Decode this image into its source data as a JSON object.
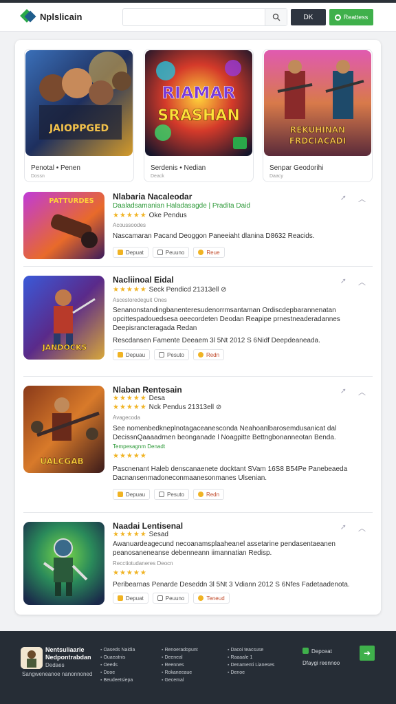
{
  "header": {
    "brand": "Nplslicain",
    "search_placeholder": "",
    "dark_button": "DK",
    "green_button": "Reattess"
  },
  "featured": [
    {
      "title": "Penotal • Penen",
      "sub": "Dossn"
    },
    {
      "title": "Serdenis • Nedian",
      "sub": "Deack"
    },
    {
      "title": "Senpar Geodorihi",
      "sub": "Daacy"
    }
  ],
  "featured_art": [
    {
      "text1": "JAIOPPGED",
      "text2": ""
    },
    {
      "text1": "RIAMAR",
      "text2": "SRASHAN"
    },
    {
      "text1": "REKUHINAN",
      "text2": "FRDCIACADI"
    }
  ],
  "rows": [
    {
      "title": "Nlabaria Nacaleodar",
      "lines": [
        {
          "text": "Daaladsamanian Haladasagde | Pradita Daid",
          "cls": "g"
        },
        {
          "text": "★★★★★  Oke  Pendus",
          "cls": "r"
        },
        {
          "text": "Acoussoodes",
          "cls": "s"
        },
        {
          "text": "Nascamaran Pacand Deoggon Paneeiaht dlanina D8632 Reacids.",
          "cls": ""
        }
      ],
      "actions": [
        "Depuat",
        "Peuuno",
        "Reue"
      ],
      "art": "PATTURDES"
    },
    {
      "title": "Nacliinoal Eidal",
      "lines": [
        {
          "text": "★★★★★  Seck Pendicd   21313ell  ⊘",
          "cls": "r"
        },
        {
          "text": "Ascestoredeguit Ones",
          "cls": "s"
        },
        {
          "text": "Senanonstandingbanenteresudenorrmsantaman Ordiscdepbarannenatan",
          "cls": ""
        },
        {
          "text": "opcittespadouedsesa oeecordeten Deodan Reapipe prnestneaderadannes",
          "cls": ""
        },
        {
          "text": "Deepisrancteragada Redan",
          "cls": ""
        },
        {
          "text": "Rescdansen Famente Deeaem 3l 5Nt 2012 S 6Nidf Deepdeaneada.",
          "cls": ""
        }
      ],
      "actions": [
        "Depuau",
        "Pesuto",
        "Redn"
      ],
      "art": "JANDOCKS"
    },
    {
      "title": "Nlaban Rentesain",
      "lines": [
        {
          "text": "★★★★★  Desa",
          "cls": "r"
        },
        {
          "text": "★★★★★  Nck Pendus   21313ell  ⊘",
          "cls": "r"
        },
        {
          "text": "Avagecoda",
          "cls": "s"
        },
        {
          "text": "See nomenbedkneplnotagaceanesconda Neahoanlbarosemdusanicat dal",
          "cls": ""
        },
        {
          "text": "DecissnQaaaadrnen beonganade l Noagpitte Bettngbonanneotan Benda.",
          "cls": ""
        },
        {
          "text": "Tempesagnm Denadt",
          "cls": "g"
        },
        {
          "text": "★★★★★",
          "cls": "r"
        },
        {
          "text": "Pascnenant Haleb denscanaenete docktant SVam 16S8 B54Pe Panebeaeda",
          "cls": ""
        },
        {
          "text": "Dacnansenmadoneconmaanesonmanes Ulsenian.",
          "cls": ""
        }
      ],
      "actions": [
        "Depuau",
        "Pesuto",
        "Redn"
      ],
      "art": "UALCGAB"
    },
    {
      "title": "Naadai Lentisenal",
      "lines": [
        {
          "text": "★★★★★  Sesad",
          "cls": "r"
        },
        {
          "text": "Awanuardeagecund necoanamsplaaheanel assetarine pendasentaeanen",
          "cls": ""
        },
        {
          "text": "peanosaneneanse debenneann iimannatian Redisp.",
          "cls": ""
        },
        {
          "text": "Recctiotudaneres Deocn",
          "cls": "s"
        },
        {
          "text": "★★★★★",
          "cls": "r"
        },
        {
          "text": "Peribearnas Penarde Deseddn 3l 5Nt 3 Vdiann 2012 S 6Nfes Fadetaadenota.",
          "cls": ""
        }
      ],
      "actions": [
        "Depuat",
        "Peuuno",
        "Teneud"
      ],
      "art": ""
    }
  ],
  "footer": {
    "brand_line1": "Nentsuliaarie",
    "brand_line2": "Nedpontrabdan",
    "brand_line3": "Dedaes",
    "tagline": "Sangweneanoe nanonnoned",
    "col1": [
      "Oaseds Naidia",
      "Ouaeatnis",
      "Oeeds",
      "Dooe",
      "Beudeetsiepa"
    ],
    "col2": [
      "Renoeradopunt",
      "Deeneal",
      "Reennes",
      "Rokaneeaue",
      "Gecemal"
    ],
    "col3": [
      "Dacoi teacsuse",
      "Raaaale 1",
      "Denamenti Lianeses",
      "Denoe"
    ],
    "right1": "Depceat",
    "right2": "Dfaygi reennoo",
    "arrow": "➜"
  }
}
